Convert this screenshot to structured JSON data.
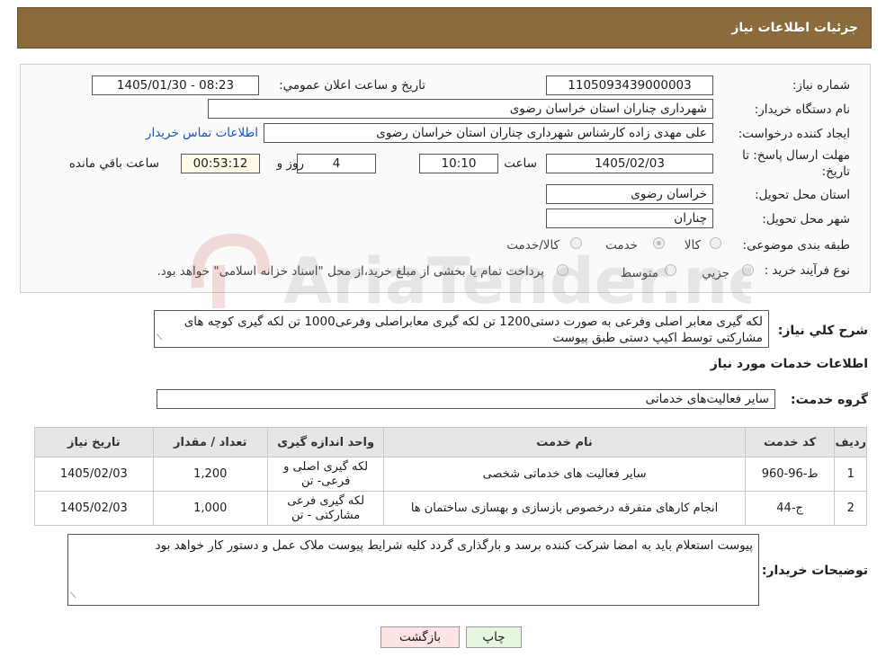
{
  "header": {
    "title": "جزئیات اطلاعات نیاز"
  },
  "form": {
    "need_number_label": "شماره نیاز:",
    "need_number": "1105093439000003",
    "announce_label": "تاریخ و ساعت اعلان عمومي:",
    "announce_value": "1405/01/30 - 08:23",
    "buyer_org_label": "نام دستگاه خريدار:",
    "buyer_org": "شهرداری چناران استان خراسان رضوی",
    "creator_label": "ايجاد کننده درخواست:",
    "creator": "علی مهدی زاده کارشناس شهرداری چناران استان خراسان رضوی",
    "contact_link": "اطلاعات تماس خريدار",
    "deadline_label_1": "مهلت ارسال پاسخ: تا",
    "deadline_label_2": "تاريخ:",
    "deadline_date": "1405/02/03",
    "time_label": "ساعت",
    "deadline_time": "10:10",
    "days_value": "4",
    "days_label": "روز و",
    "remaining_time": "00:53:12",
    "remaining_label": "ساعت باقي مانده",
    "province_label": "استان محل تحويل:",
    "province": "خراسان رضوی",
    "city_label": "شهر محل تحويل:",
    "city": "چناران",
    "category_label": "طبقه بندی موضوعی:",
    "category_options": [
      "کالا",
      "خدمت",
      "کالا/خدمت"
    ],
    "category_selected": "خدمت",
    "process_label": "نوع فرآيند خريد :",
    "process_options": [
      "جزيي",
      "متوسط"
    ],
    "process_note": "پرداخت تمام يا بخشی از مبلغ خريد،از محل \"اسناد خزانه اسلامی\" خواهد بود."
  },
  "description": {
    "label": "شرح کلي نياز:",
    "text": "لکه گیری معابر اصلی وفرعی به صورت دستی1200 تن لکه گیری معابراصلی وفرعی1000 تن لکه گیری کوچه های مشارکتی توسط اکیپ دستی طبق پیوست"
  },
  "services": {
    "section_title": "اطلاعات خدمات مورد نياز",
    "group_label": "گروه خدمت:",
    "group_value": "ساير فعاليت‌های خدماتی",
    "columns": [
      "رديف",
      "کد خدمت",
      "نام خدمت",
      "واحد اندازه گيری",
      "تعداد / مقدار",
      "تاريخ نياز"
    ],
    "rows": [
      {
        "row": "1",
        "code": "ط-96-960",
        "name": "سایر فعالیت های خدماتی شخصی",
        "unit": "لکه گیری اصلی و فرعی- تن",
        "qty": "1,200",
        "date": "1405/02/03"
      },
      {
        "row": "2",
        "code": "ج-44",
        "name": "انجام کارهای متفرقه درخصوص بازسازی و بهسازی ساختمان ها",
        "unit": "لکه گیری فرعی مشارکتی - تن",
        "qty": "1,000",
        "date": "1405/02/03"
      }
    ]
  },
  "buyer_notes": {
    "label": "توضيحات خريدار:",
    "text": "پیوست استعلام باید به امضا شرکت کننده برسد و بارگذاری گردد کلیه شرایط پیوست ملاک عمل و دستور کار خواهد بود"
  },
  "buttons": {
    "print": "چاپ",
    "back": "بازگشت"
  },
  "watermark": {
    "text": "AriaTender.net"
  },
  "colors": {
    "header_bg": "#8c6a3c",
    "back_button_bg": "#fde4e4",
    "print_button_bg": "#e6f6e0",
    "link": "#1a55c0"
  }
}
